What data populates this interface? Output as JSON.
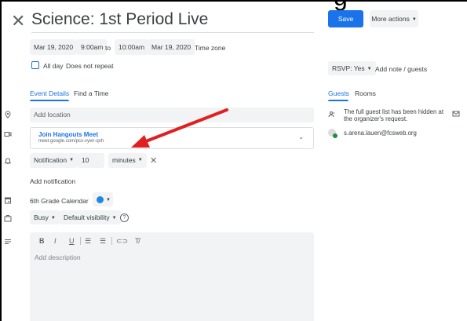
{
  "event": {
    "title": "Science: 1st Period Live",
    "start_date": "Mar 19, 2020",
    "start_time": "9:00am",
    "to_label": "to",
    "end_time": "10:00am",
    "end_date": "Mar 19, 2020",
    "time_zone_label": "Time zone",
    "all_day_label": "All day",
    "repeat_label": "Does not repeat"
  },
  "tabs": [
    {
      "label": "Event Details",
      "active": true
    },
    {
      "label": "Find a Time",
      "active": false
    }
  ],
  "location": {
    "placeholder": "Add location"
  },
  "meet": {
    "title": "Join Hangouts Meet",
    "url": "meet.google.com/pcx-xywr-qxh"
  },
  "notification": {
    "type": "Notification",
    "value": "10",
    "unit": "minutes",
    "add_label": "Add notification"
  },
  "calendar": {
    "name": "6th Grade Calendar",
    "color": "#1e88e5"
  },
  "availability": {
    "status": "Busy",
    "visibility": "Default visibility"
  },
  "editor": {
    "placeholder": "Add description",
    "tools": [
      "B",
      "I",
      "U",
      "ordered-list",
      "bulleted-list",
      "link",
      "clear-format"
    ]
  },
  "header": {
    "save_label": "Save",
    "more_actions_label": "More actions"
  },
  "rsvp": {
    "label": "RSVP: Yes",
    "note_label": "Add note / guests"
  },
  "right_tabs": [
    {
      "label": "Guests",
      "active": true
    },
    {
      "label": "Rooms",
      "active": false
    }
  ],
  "guests": {
    "hidden_notice": "The full guest list has been hidden at the organizer's request.",
    "items": [
      {
        "email": "s.arena.lauen@fcsweb.org"
      }
    ]
  },
  "overlay": {
    "cut_text": "g"
  },
  "colors": {
    "accent": "#1a73e8",
    "annotation_arrow": "#e02020"
  }
}
